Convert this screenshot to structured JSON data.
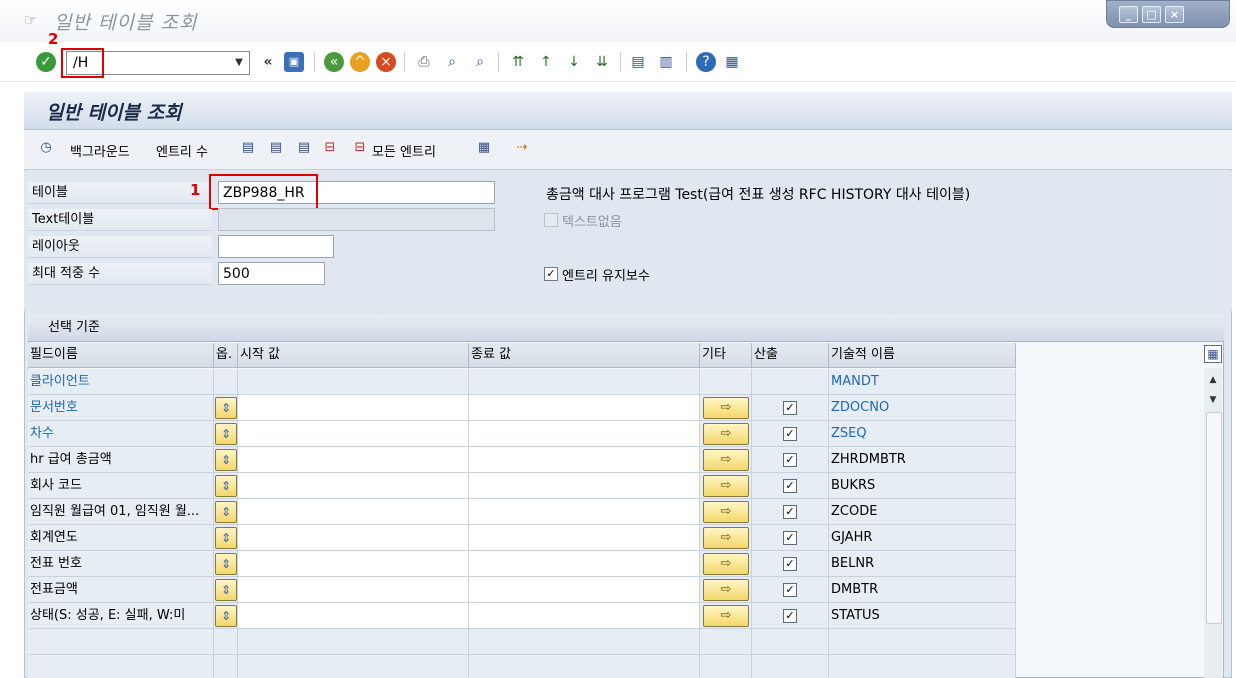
{
  "window": {
    "title": "일반 테이블 조회",
    "controls": {
      "minimize": "_",
      "maximize": "□",
      "close": "×"
    }
  },
  "system_toolbar": {
    "command_value": "/H",
    "icons": [
      "enter-icon",
      "back-icon",
      "save-icon",
      "back-nav-icon",
      "exit-icon",
      "cancel-icon",
      "print-icon",
      "find-icon",
      "find-next-icon",
      "first-page-icon",
      "prev-page-icon",
      "next-page-icon",
      "last-page-icon",
      "new-session-icon",
      "shortcut-icon",
      "help-icon",
      "customize-icon"
    ]
  },
  "annotations": {
    "label_1": "1",
    "label_2": "2"
  },
  "app": {
    "title": "일반 테이블 조회",
    "toolbar": {
      "background_label": "백그라운드",
      "entry_count_label": "엔트리 수",
      "all_entries_label": "모든 엔트리"
    }
  },
  "form": {
    "table_label": "테이블",
    "table_value": "ZBP988_HR",
    "table_description": "총금액 대사 프로그램 Test(급여 전표 생성 RFC HISTORY 대사 테이블)",
    "text_table_label": "Text테이블",
    "text_table_value": "",
    "no_text_label": "텍스트없음",
    "no_text_checked": false,
    "layout_label": "레이아웃",
    "layout_value": "",
    "max_hits_label": "최대 적중 수",
    "max_hits_value": "500",
    "maintain_entries_label": "엔트리 유지보수",
    "maintain_entries_checked": true
  },
  "selection": {
    "title": "선택 기준",
    "headers": {
      "field_name": "필드이름",
      "option": "옵.",
      "from_value": "시작 값",
      "to_value": "종료 값",
      "more": "기타",
      "output": "산출",
      "technical_name": "기술적 이름"
    },
    "rows": [
      {
        "field": "클라이언트",
        "tech": "MANDT",
        "link": true,
        "has_controls": false,
        "output": false
      },
      {
        "field": "문서번호",
        "tech": "ZDOCNO",
        "link": true,
        "has_controls": true,
        "output": true
      },
      {
        "field": "차수",
        "tech": "ZSEQ",
        "link": true,
        "has_controls": true,
        "output": true
      },
      {
        "field": "hr 급여 총금액",
        "tech": "ZHRDMBTR",
        "link": false,
        "has_controls": true,
        "output": true
      },
      {
        "field": "회사 코드",
        "tech": "BUKRS",
        "link": false,
        "has_controls": true,
        "output": true
      },
      {
        "field": "임직원 월급여 01, 임직원 월...",
        "tech": "ZCODE",
        "link": false,
        "has_controls": true,
        "output": true
      },
      {
        "field": "회계연도",
        "tech": "GJAHR",
        "link": false,
        "has_controls": true,
        "output": true
      },
      {
        "field": "전표 번호",
        "tech": "BELNR",
        "link": false,
        "has_controls": true,
        "output": true
      },
      {
        "field": "전표금액",
        "tech": "DMBTR",
        "link": false,
        "has_controls": true,
        "output": true
      },
      {
        "field": "상태(S: 성공, E: 실패, W:미",
        "tech": "STATUS",
        "link": false,
        "has_controls": true,
        "output": true
      }
    ]
  }
}
